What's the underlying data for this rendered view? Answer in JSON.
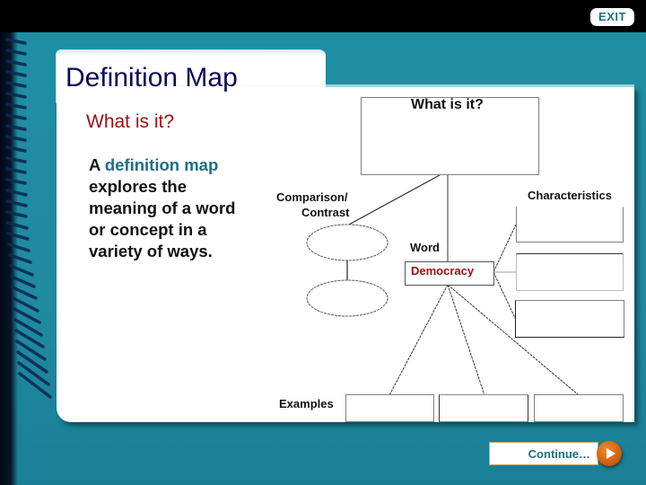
{
  "header": {
    "exit_label": "EXIT"
  },
  "slide": {
    "title": "Definition Map",
    "subtitle": "What is it?",
    "description": {
      "prefix": "A ",
      "highlight": "definition map",
      "suffix": " explores the meaning of a word or concept in a variety of ways."
    }
  },
  "diagram": {
    "what_is_it_label": "What is it?",
    "comparison_label_line1": "Comparison/",
    "comparison_label_line2": "Contrast",
    "characteristics_label": "Characteristics",
    "word_label": "Word",
    "word_value": "Democracy",
    "examples_label": "Examples"
  },
  "footer": {
    "continue_label": "Continue…",
    "play_icon": "play-icon"
  },
  "colors": {
    "teal": "#1f8ea3",
    "title": "#0a0a5a",
    "red": "#a10f14",
    "highlight": "#1e6f8a",
    "orange": "#e07518"
  }
}
